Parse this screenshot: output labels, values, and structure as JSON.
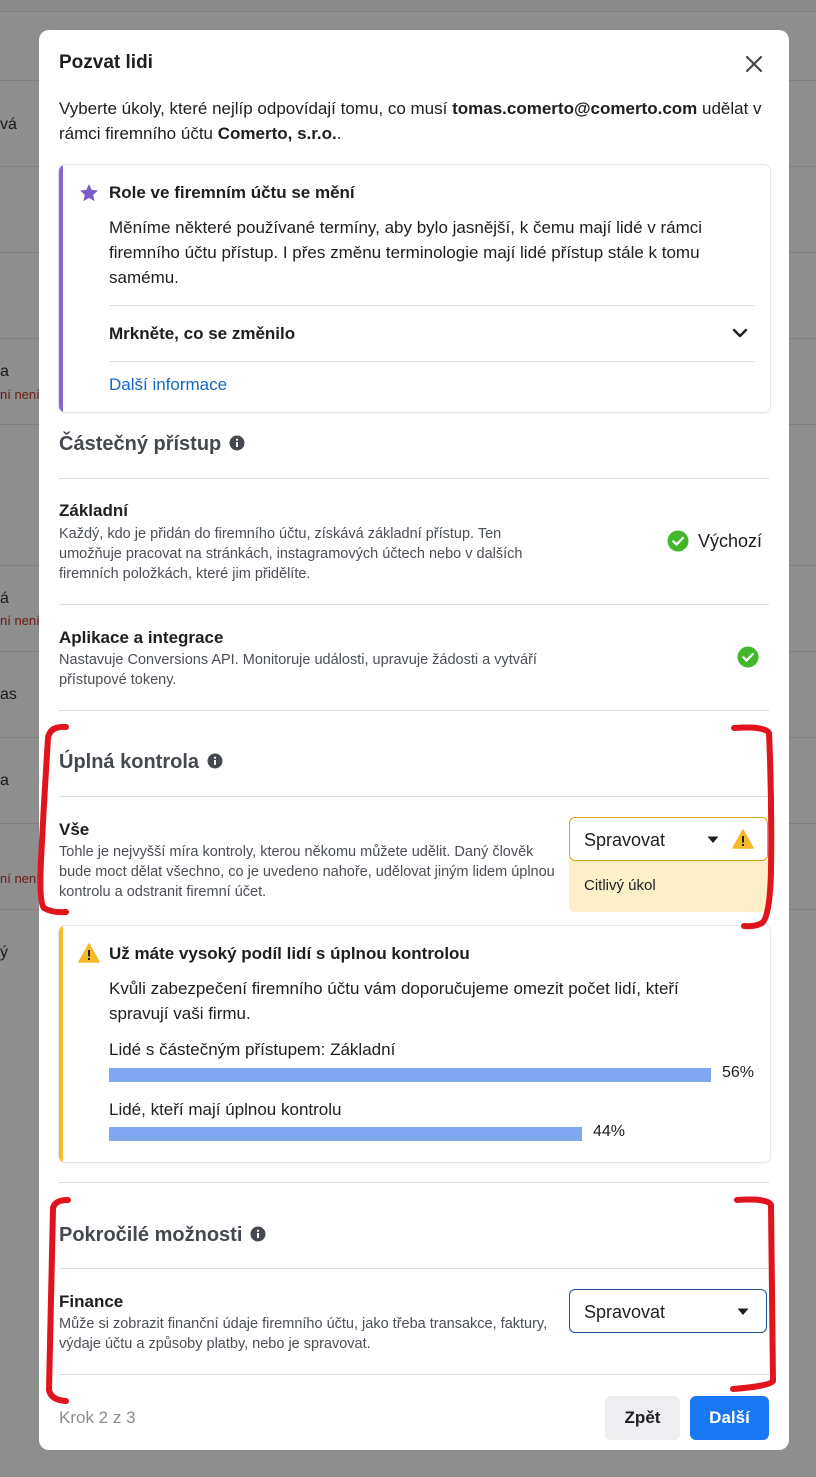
{
  "background": {
    "texts": [
      {
        "text": "vá"
      },
      {
        "text": "a"
      },
      {
        "text": "ní není",
        "warning": true
      },
      {
        "text": "á"
      },
      {
        "text": "ní není",
        "warning": true
      },
      {
        "text": "as"
      },
      {
        "text": "a"
      },
      {
        "text": "ní není",
        "warning": true
      },
      {
        "text": "ý"
      }
    ]
  },
  "modal": {
    "title": "Pozvat lidi",
    "close_icon": "close-icon",
    "intro": {
      "prefix": "Vyberte úkoly, které nejlíp odpovídají tomu, co musí ",
      "email": "tomas.comerto@comerto.com",
      "middle": " udělat v rámci firemního účtu ",
      "company": "Comerto, s.r.o.",
      "suffix": "."
    }
  },
  "notice": {
    "accent_color": "#8a65c9",
    "icon": "star-icon",
    "title": "Role ve firemním účtu se mění",
    "body": "Měníme některé používané termíny, aby bylo jasnější, k čemu mají lidé v rámci firemního účtu přístup. I přes změnu terminologie mají lidé přístup stále k tomu samému.",
    "expander_label": "Mrkněte, co se změnilo",
    "expander_icon": "chevron-down-icon",
    "link": "Další informace"
  },
  "partial_access": {
    "heading": "Částečný přístup",
    "items": [
      {
        "title": "Základní",
        "description": "Každý, kdo je přidán do firemního účtu, získává základní přístup. Ten umožňuje pracovat na stránkách, instagramových účtech nebo v dalších firemních položkách, které jim přidělíte.",
        "status_label": "Výchozí",
        "checked": true
      },
      {
        "title": "Aplikace a integrace",
        "description": "Nastavuje Conversions API. Monitoruje události, upravuje žádosti a vytváří přístupové tokeny.",
        "checked": true
      }
    ]
  },
  "full_control": {
    "heading": "Úplná kontrola",
    "item": {
      "title": "Vše",
      "description": "Tohle je nejvyšší míra kontroly, kterou někomu můžete udělit. Daný člověk bude moct dělat všechno, co je uvedeno nahoře, udělovat jiným lidem úplnou kontrolu a odstranit firemní účet.",
      "select_value": "Spravovat",
      "sensitive_label": "Citlivý úkol"
    }
  },
  "warning": {
    "accent_color": "#f7b928",
    "icon": "warning-icon",
    "title": "Už máte vysoký podíl lidí s úplnou kontrolou",
    "body": "Kvůli zabezpečení firemního účtu vám doporučujeme omezit počet lidí, kteří spravují vaši firmu.",
    "bars": [
      {
        "label": "Lidé s částečným přístupem: Základní",
        "value": 56,
        "display": "56%"
      },
      {
        "label": "Lidé, kteří mají úplnou kontrolu",
        "value": 44,
        "display": "44%"
      }
    ]
  },
  "advanced": {
    "heading": "Pokročilé možnosti",
    "item": {
      "title": "Finance",
      "description": "Může si zobrazit finanční údaje firemního účtu, jako třeba transakce, faktury, výdaje účtu a způsoby platby, nebo je spravovat.",
      "select_value": "Spravovat"
    }
  },
  "footer": {
    "step": "Krok 2 z 3",
    "back_label": "Zpět",
    "next_label": "Další"
  },
  "colors": {
    "primary": "#1877f2",
    "link": "#1467c8",
    "check": "#42b72a",
    "annotation": "#e0141c",
    "bar": "#80a7ef"
  }
}
